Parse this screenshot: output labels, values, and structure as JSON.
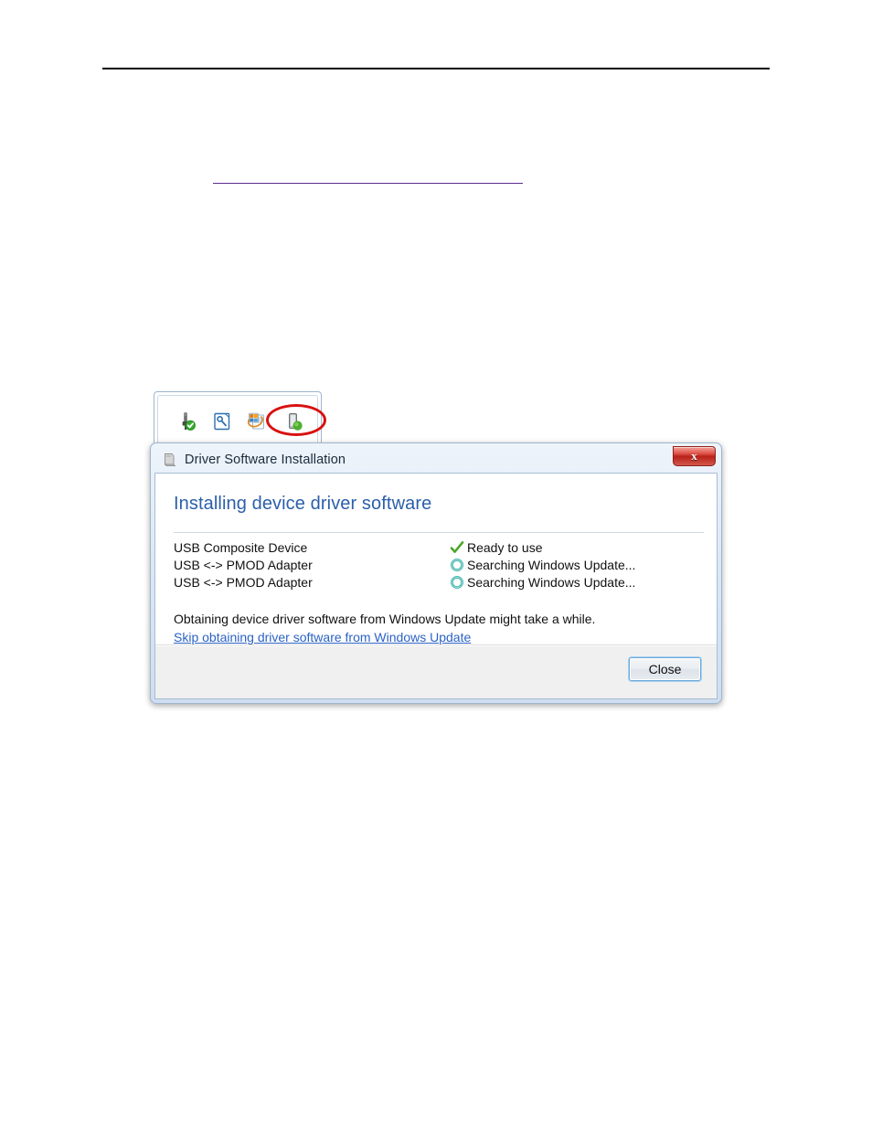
{
  "page": {
    "top_rule": "horizontal-rule",
    "hyperlink_rule": "underlined-hyperlink-placeholder"
  },
  "tray": {
    "icons": [
      {
        "name": "usb-device-ok-icon",
        "label": "USB device ready"
      },
      {
        "name": "hardware-wizard-icon",
        "label": "Found new hardware"
      },
      {
        "name": "windows-update-icon",
        "label": "Windows Update"
      },
      {
        "name": "safely-remove-hardware-icon",
        "label": "Safely remove hardware"
      }
    ],
    "highlight": "red-ellipse-annotation"
  },
  "dialog": {
    "title": "Driver Software Installation",
    "title_icon": "driver-software-icon",
    "close_x_label": "x",
    "heading": "Installing device driver software",
    "devices": [
      {
        "name": "USB Composite Device",
        "status": "Ready to use",
        "status_icon": "green-check-icon"
      },
      {
        "name": "USB <-> PMOD Adapter",
        "status": "Searching Windows Update...",
        "status_icon": "progress-ring-icon"
      },
      {
        "name": "USB <-> PMOD Adapter",
        "status": "Searching Windows Update...",
        "status_icon": "progress-ring-icon"
      }
    ],
    "note": "Obtaining device driver software from Windows Update might take a while.",
    "skip_link": "Skip obtaining driver software from Windows Update",
    "close_button": "Close",
    "colors": {
      "heading": "#2b5faa",
      "link": "#2b62c6",
      "check": "#4ea62a",
      "ring": "#2aa6a0",
      "close_x": "#b92119",
      "page_link_rule": "#5b2d8e"
    }
  }
}
